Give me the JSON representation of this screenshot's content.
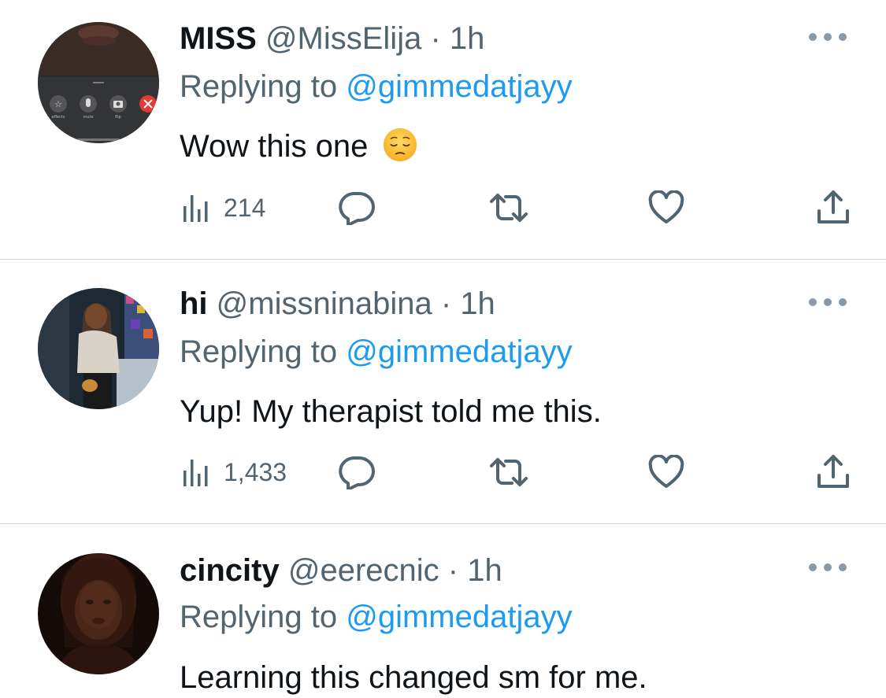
{
  "tweets": [
    {
      "display_name": "MISS",
      "handle": "@MissElija",
      "separator": "·",
      "time": "1h",
      "replying_prefix": "Replying to ",
      "replying_to": "@gimmedatjayy",
      "text": "Wow this one",
      "emoji": "pensive-face",
      "views": "214",
      "avatar_icons": [
        "effects",
        "mute",
        "flip"
      ]
    },
    {
      "display_name": "hi",
      "handle": "@missninabina",
      "separator": "·",
      "time": "1h",
      "replying_prefix": "Replying to ",
      "replying_to": "@gimmedatjayy",
      "text": "Yup! My therapist told me this.",
      "views": "1,433"
    },
    {
      "display_name": "cincity",
      "handle": "@eerecnic",
      "separator": "·",
      "time": "1h",
      "replying_prefix": "Replying to ",
      "replying_to": "@gimmedatjayy",
      "text": "Learning this changed sm for me."
    }
  ],
  "icons": {
    "views": "bar-chart-icon",
    "reply": "speech-bubble-icon",
    "retweet": "retweet-icon",
    "like": "heart-icon",
    "share": "share-upload-icon",
    "more": "more-dots-icon"
  },
  "colors": {
    "text_primary": "#0f1419",
    "text_secondary": "#536471",
    "link": "#1d9bf0",
    "divider": "#d5d9dd"
  }
}
